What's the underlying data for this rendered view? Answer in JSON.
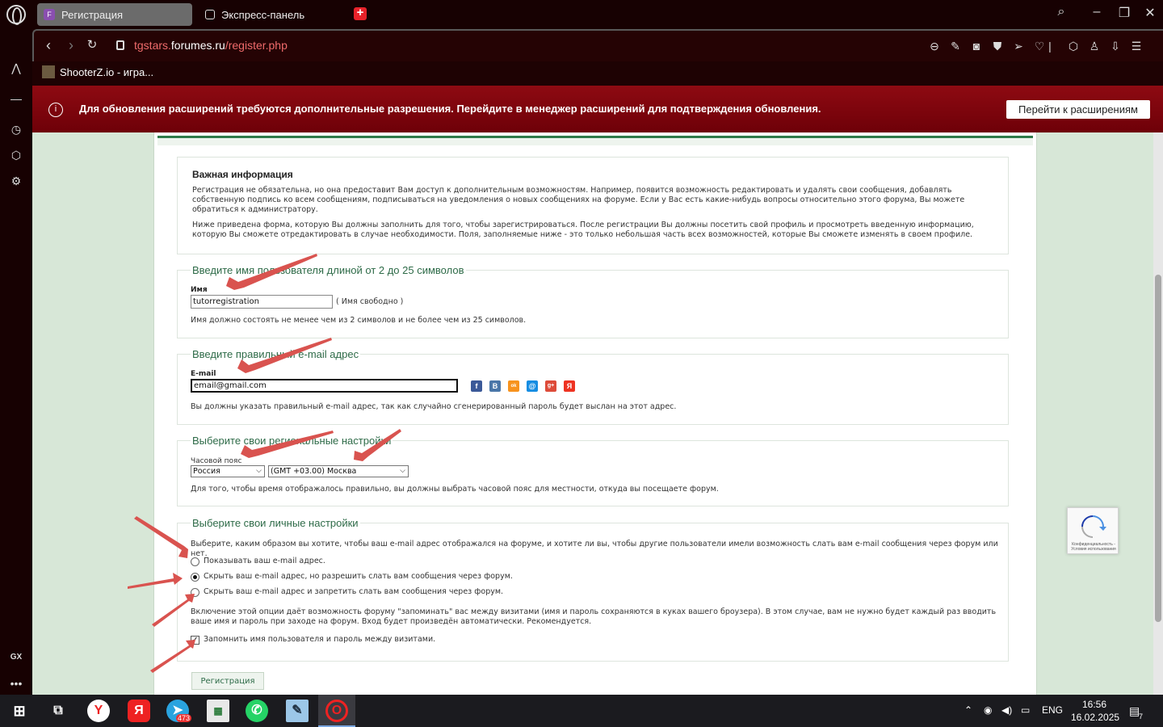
{
  "browser": {
    "tabs": [
      {
        "label": "Регистрация",
        "favicon": "F"
      },
      {
        "label": "Экспресс-панель"
      }
    ],
    "url": {
      "scheme": "tgstars.",
      "domain": "forumes.ru",
      "path": "/register.php"
    },
    "bookmark": "ShooterZ.io - игра...",
    "sidebar_gx": "GX"
  },
  "notification": {
    "text": "Для обновления расширений требуются дополнительные разрешения. Перейдите в менеджер расширений для подтверждения обновления.",
    "button": "Перейти к расширениям"
  },
  "info": {
    "title": "Важная информация",
    "p1": "Регистрация не обязательна, но она предоставит Вам доступ к дополнительным возможностям. Например, появится возможность редактировать и удалять свои сообщения, добавлять собственную подпись ко всем сообщениям, подписываться на уведомления о новых сообщениях на форуме. Если у Вас есть какие-нибудь вопросы относительно этого форума, Вы можете обратиться к администратору.",
    "p2": "Ниже приведена форма, которую Вы должны заполнить для того, чтобы зарегистрироваться. После регистрации Вы должны посетить свой профиль и просмотреть введенную информацию, которую Вы сможете отредактировать в случае необходимости. Поля, заполняемые ниже - это только небольшая часть всех возможностей, которые Вы сможете изменять в своем профиле."
  },
  "name_section": {
    "legend": "Введите имя пользователя длиной от 2 до 25 символов",
    "label": "Имя",
    "value": "tutorregistration",
    "status": "( Имя свободно )",
    "hint": "Имя должно состоять не менее чем из 2 символов и не более чем из 25 символов."
  },
  "email_section": {
    "legend": "Введите правильный e-mail адрес",
    "label": "E-mail",
    "value": "email@gmail.com",
    "social": [
      "f",
      "B",
      "ok",
      "@",
      "g+",
      "Я"
    ],
    "hint": "Вы должны указать правильный e-mail адрес, так как случайно сгенерированный пароль будет выслан на этот адрес."
  },
  "tz_section": {
    "legend": "Выберите свои региональные настройки",
    "label": "Часовой пояс",
    "country": "Россия",
    "zone": "(GMT +03.00) Москва",
    "hint": "Для того, чтобы время отображалось правильно, вы должны выбрать часовой пояс для местности, откуда вы посещаете форум."
  },
  "personal_section": {
    "legend": "Выберите свои личные настройки",
    "intro": "Выберите, каким образом вы хотите, чтобы ваш e-mail адрес отображался на форуме, и хотите ли вы, чтобы другие пользователи имели возможность слать вам e-mail сообщения через форум или нет.",
    "options": [
      {
        "label": "Показывать ваш e-mail адрес.",
        "selected": false
      },
      {
        "label": "Скрыть ваш e-mail адрес, но разрешить слать вам сообщения через форум.",
        "selected": true
      },
      {
        "label": "Скрыть ваш e-mail адрес и запретить слать вам сообщения через форум.",
        "selected": false
      }
    ],
    "remember_text": "Включение этой опции даёт возможность форуму \"запоминать\" вас между визитами (имя и пароль сохраняются в куках вашего броузера). В этом случае, вам не нужно будет каждый раз вводить ваше имя и пароль при заходе на форум. Вход будет произведён автоматически. Рекомендуется.",
    "remember_label": "Запомнить имя пользователя и пароль между визитами.",
    "remember_checked": true
  },
  "submit": "Регистрация",
  "recaptcha_text": "Конфиденциальность - Условия использования",
  "taskbar": {
    "telegram_badge": "473",
    "lang": "ENG",
    "time": "16:56",
    "date": "16.02.2025",
    "notif_count": "7"
  },
  "colors": {
    "annotation_arrow": "#d9534f",
    "legend": "#2e6b48",
    "notify_bg": "#8e0a12"
  }
}
